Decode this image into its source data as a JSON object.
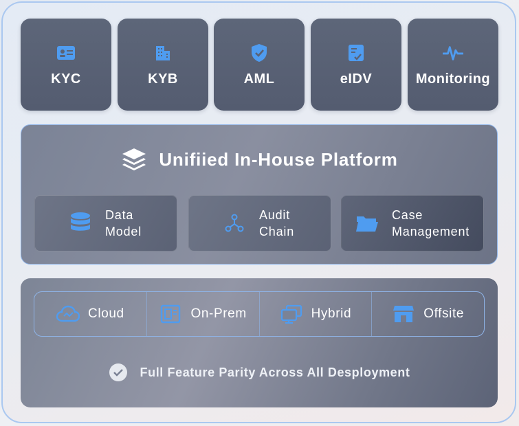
{
  "modules": [
    {
      "label": "KYC",
      "icon": "id-card-icon"
    },
    {
      "label": "KYB",
      "icon": "building-icon"
    },
    {
      "label": "AML",
      "icon": "shield-check-icon"
    },
    {
      "label": "eIDV",
      "icon": "checklist-icon"
    },
    {
      "label": "Monitoring",
      "icon": "pulse-icon"
    }
  ],
  "platform": {
    "title": "Unifiied In-House Platform",
    "icon": "layers-icon",
    "cards": [
      {
        "line1": "Data",
        "line2": "Model",
        "icon": "database-icon"
      },
      {
        "line1": "Audit",
        "line2": "Chain",
        "icon": "chain-nodes-icon"
      },
      {
        "line1": "Case",
        "line2": "Management",
        "icon": "folder-icon"
      }
    ]
  },
  "deployment": {
    "options": [
      {
        "label": "Cloud",
        "icon": "cloud-icon"
      },
      {
        "label": "On-Prem",
        "icon": "server-icon"
      },
      {
        "label": "Hybrid",
        "icon": "hybrid-screens-icon"
      },
      {
        "label": "Offsite",
        "icon": "store-icon"
      }
    ],
    "parity": "Full Feature Parity Across All Desployment"
  },
  "colors": {
    "accent": "#4f9cf0",
    "border": "#8fb4e8"
  }
}
